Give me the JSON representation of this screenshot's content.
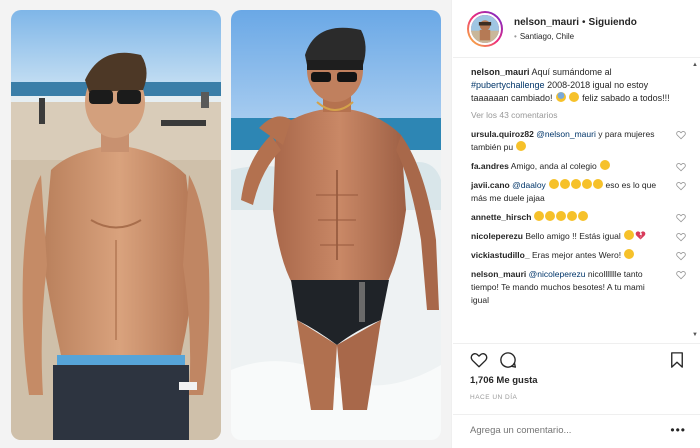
{
  "header": {
    "username": "nelson_mauri",
    "separator": "•",
    "follow_status": "Siguiendo",
    "location_dot": "•",
    "location": "Santiago, Chile"
  },
  "caption": {
    "username": "nelson_mauri",
    "text_before": " Aquí sumándome al ",
    "hashtag": "#pubertychallenge",
    "text_after": " 2008-2018 igual no estoy taaaaaan cambiado! ",
    "text_end": " feliz sabado a todos!!!"
  },
  "view_all_comments": "Ver los 43 comentarios",
  "comments": [
    {
      "user": "ursula.quiroz82",
      "mention": "@nelson_mauri",
      "text": " y para mujeres también pu "
    },
    {
      "user": "fa.andres",
      "mention": "",
      "text": " Amigo, anda al colegio "
    },
    {
      "user": "javii.cano",
      "mention": "@daaloy",
      "text": " eso es lo que más me duele jajaa"
    },
    {
      "user": "annette_hirsch",
      "mention": "",
      "text": ""
    },
    {
      "user": "nicoleperezu",
      "mention": "",
      "text": " Bello amigo !! Estás igual"
    },
    {
      "user": "vickiastudillo_",
      "mention": "",
      "text": " Eras mejor antes Wero!"
    },
    {
      "user": "nelson_mauri",
      "mention": "@nicoleperezu",
      "text": " nicollllllle tanto tiempo! Te mando muchos besotes! A tu mami igual"
    }
  ],
  "likes": "1,706 Me gusta",
  "timestamp": "HACE UN DÍA",
  "add_comment": {
    "placeholder": "Agrega un comentario...",
    "more": "•••"
  },
  "icons": {
    "like": "heart-outline-icon",
    "comment": "speech-bubble-icon",
    "save": "bookmark-icon",
    "comment_like": "small-heart-icon"
  },
  "colors": {
    "link": "#003569",
    "muted": "#999999",
    "text": "#262626",
    "story_ring_start": "#f9ce34",
    "story_ring_end": "#6228d7"
  }
}
